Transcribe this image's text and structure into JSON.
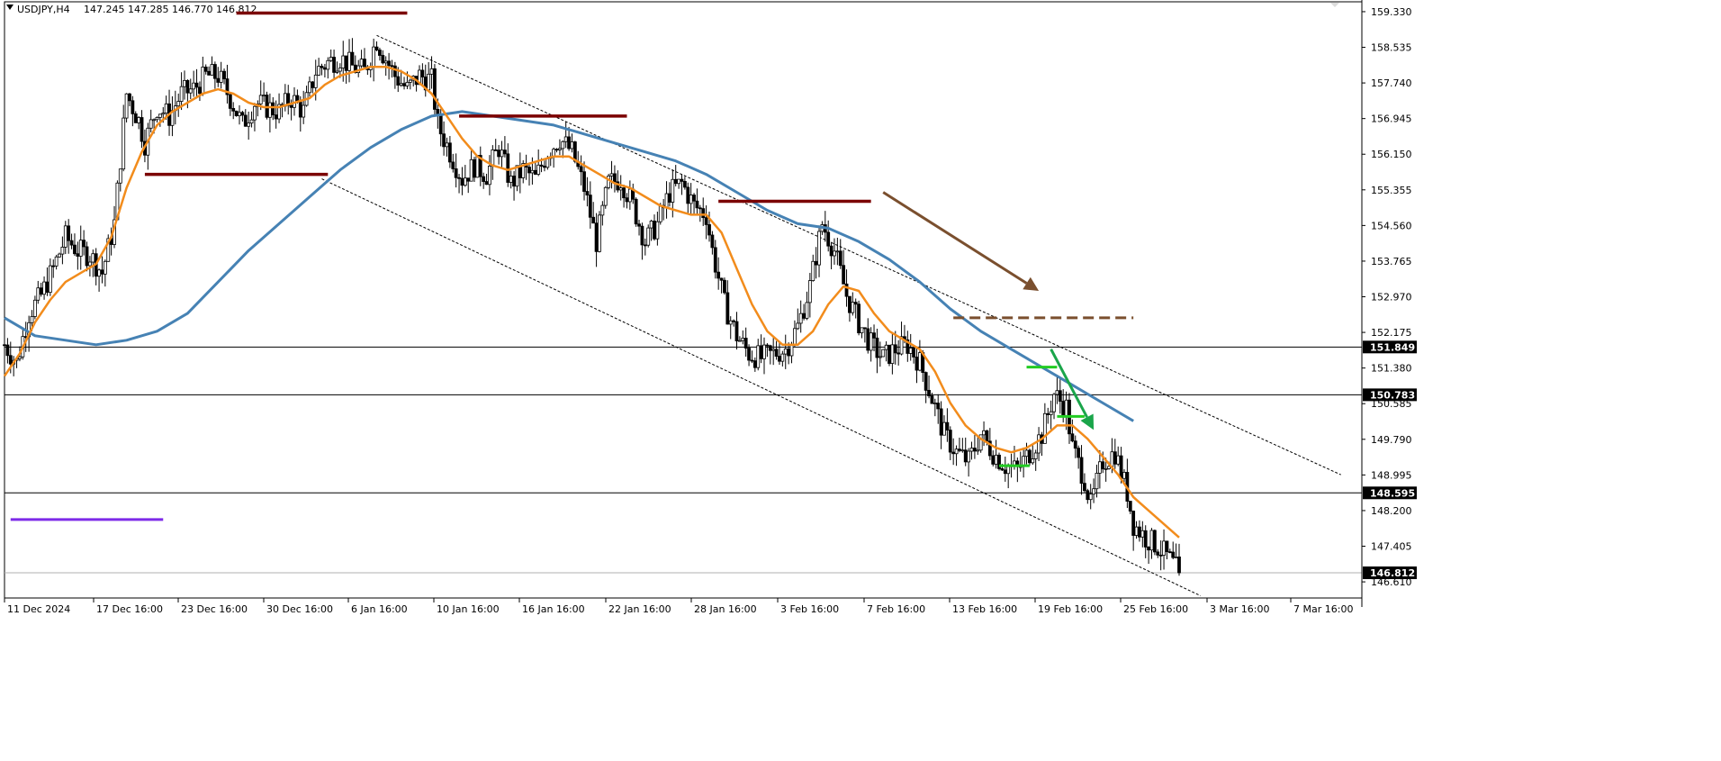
{
  "header": {
    "symbol": "USDJPY,H4",
    "ohlc": "147.245 147.285 146.770 146.812"
  },
  "colors": {
    "background": "#ffffff",
    "candle": "#000000",
    "fast_ma": "#f28c1c",
    "slow_ma": "#4682b4",
    "resistance": "#7b0000",
    "support": "#7d2ae8",
    "projection": "#7a4f2e",
    "signal": "#22cc22",
    "signal_arrow": "#1aa54a",
    "level_line": "#000000",
    "channel": "#000000"
  },
  "chart_data": {
    "type": "candlestick",
    "symbol": "USDJPY",
    "timeframe": "H4",
    "y_ticks": [
      "159.330",
      "158.535",
      "157.740",
      "156.945",
      "156.150",
      "155.355",
      "154.560",
      "153.765",
      "152.970",
      "152.175",
      "151.380",
      "150.585",
      "149.790",
      "148.995",
      "148.200",
      "147.405",
      "146.610"
    ],
    "y_range": [
      146.25,
      159.55
    ],
    "x_ticks": [
      "11 Dec 2024",
      "17 Dec 16:00",
      "23 Dec 16:00",
      "30 Dec 16:00",
      "6 Jan 16:00",
      "10 Jan 16:00",
      "16 Jan 16:00",
      "22 Jan 16:00",
      "28 Jan 16:00",
      "3 Feb 16:00",
      "7 Feb 16:00",
      "13 Feb 16:00",
      "19 Feb 16:00",
      "25 Feb 16:00",
      "3 Mar 16:00",
      "7 Mar 16:00"
    ],
    "x_range_bars": [
      0,
      500
    ],
    "last_bar": 385,
    "price_badges": [
      {
        "label": "151.849",
        "value": 151.849,
        "line": true
      },
      {
        "label": "150.783",
        "value": 150.783,
        "line": true
      },
      {
        "label": "148.595",
        "value": 148.595,
        "line": true
      },
      {
        "label": "146.812",
        "value": 146.812,
        "line": false
      }
    ],
    "price_path": [
      [
        0,
        151.9
      ],
      [
        4,
        151.5
      ],
      [
        8,
        152.6
      ],
      [
        12,
        153.0
      ],
      [
        16,
        153.6
      ],
      [
        20,
        154.3
      ],
      [
        24,
        154.0
      ],
      [
        28,
        153.9
      ],
      [
        32,
        153.5
      ],
      [
        36,
        154.6
      ],
      [
        40,
        157.5
      ],
      [
        44,
        156.9
      ],
      [
        46,
        156.4
      ],
      [
        50,
        157.2
      ],
      [
        54,
        157.0
      ],
      [
        58,
        157.5
      ],
      [
        62,
        157.6
      ],
      [
        66,
        157.9
      ],
      [
        70,
        157.9
      ],
      [
        74,
        157.4
      ],
      [
        78,
        156.8
      ],
      [
        82,
        157.3
      ],
      [
        86,
        157.2
      ],
      [
        90,
        157.1
      ],
      [
        94,
        157.4
      ],
      [
        98,
        157.1
      ],
      [
        102,
        158.0
      ],
      [
        106,
        158.2
      ],
      [
        110,
        158.3
      ],
      [
        114,
        158.1
      ],
      [
        118,
        158.0
      ],
      [
        122,
        158.7
      ],
      [
        124,
        158.4
      ],
      [
        128,
        157.9
      ],
      [
        132,
        157.6
      ],
      [
        136,
        157.9
      ],
      [
        140,
        157.8
      ],
      [
        142,
        156.8
      ],
      [
        146,
        156.2
      ],
      [
        150,
        155.6
      ],
      [
        154,
        155.9
      ],
      [
        158,
        155.7
      ],
      [
        162,
        156.3
      ],
      [
        166,
        155.5
      ],
      [
        170,
        155.8
      ],
      [
        174,
        155.6
      ],
      [
        178,
        156.2
      ],
      [
        182,
        156.5
      ],
      [
        186,
        156.2
      ],
      [
        190,
        155.4
      ],
      [
        194,
        154.2
      ],
      [
        198,
        155.5
      ],
      [
        202,
        155.6
      ],
      [
        206,
        155.0
      ],
      [
        210,
        154.2
      ],
      [
        214,
        154.6
      ],
      [
        218,
        155.3
      ],
      [
        222,
        155.5
      ],
      [
        226,
        155.0
      ],
      [
        230,
        154.8
      ],
      [
        232,
        154.0
      ],
      [
        236,
        152.8
      ],
      [
        240,
        152.1
      ],
      [
        244,
        151.7
      ],
      [
        248,
        151.6
      ],
      [
        252,
        151.7
      ],
      [
        256,
        151.8
      ],
      [
        260,
        152.3
      ],
      [
        264,
        153.2
      ],
      [
        268,
        154.6
      ],
      [
        272,
        154.0
      ],
      [
        276,
        153.0
      ],
      [
        280,
        152.4
      ],
      [
        284,
        151.9
      ],
      [
        288,
        151.6
      ],
      [
        292,
        151.8
      ],
      [
        296,
        151.9
      ],
      [
        300,
        151.5
      ],
      [
        304,
        150.7
      ],
      [
        308,
        149.9
      ],
      [
        312,
        149.5
      ],
      [
        316,
        149.3
      ],
      [
        320,
        149.9
      ],
      [
        324,
        149.5
      ],
      [
        328,
        149.2
      ],
      [
        332,
        149.1
      ],
      [
        336,
        149.5
      ],
      [
        340,
        149.9
      ],
      [
        344,
        150.8
      ],
      [
        348,
        150.5
      ],
      [
        350,
        149.6
      ],
      [
        354,
        148.9
      ],
      [
        356,
        148.3
      ],
      [
        360,
        149.3
      ],
      [
        364,
        149.5
      ],
      [
        368,
        148.6
      ],
      [
        370,
        147.9
      ],
      [
        374,
        147.6
      ],
      [
        378,
        147.4
      ],
      [
        382,
        147.1
      ],
      [
        385,
        146.812
      ]
    ],
    "fast_ma_points": [
      [
        0,
        151.2
      ],
      [
        5,
        151.7
      ],
      [
        10,
        152.4
      ],
      [
        15,
        152.9
      ],
      [
        20,
        153.3
      ],
      [
        25,
        153.5
      ],
      [
        30,
        153.7
      ],
      [
        35,
        154.3
      ],
      [
        40,
        155.4
      ],
      [
        45,
        156.2
      ],
      [
        50,
        156.8
      ],
      [
        55,
        157.1
      ],
      [
        60,
        157.3
      ],
      [
        65,
        157.5
      ],
      [
        70,
        157.6
      ],
      [
        75,
        157.5
      ],
      [
        80,
        157.3
      ],
      [
        85,
        157.2
      ],
      [
        90,
        157.2
      ],
      [
        95,
        157.3
      ],
      [
        100,
        157.4
      ],
      [
        105,
        157.7
      ],
      [
        110,
        157.9
      ],
      [
        115,
        158.0
      ],
      [
        120,
        158.1
      ],
      [
        125,
        158.1
      ],
      [
        130,
        158.0
      ],
      [
        135,
        157.8
      ],
      [
        140,
        157.5
      ],
      [
        145,
        157.0
      ],
      [
        150,
        156.5
      ],
      [
        155,
        156.1
      ],
      [
        160,
        155.9
      ],
      [
        165,
        155.8
      ],
      [
        170,
        155.9
      ],
      [
        175,
        156.0
      ],
      [
        180,
        156.1
      ],
      [
        185,
        156.1
      ],
      [
        190,
        155.9
      ],
      [
        195,
        155.7
      ],
      [
        200,
        155.5
      ],
      [
        205,
        155.4
      ],
      [
        210,
        155.2
      ],
      [
        215,
        155.0
      ],
      [
        220,
        154.9
      ],
      [
        225,
        154.8
      ],
      [
        230,
        154.8
      ],
      [
        235,
        154.4
      ],
      [
        240,
        153.6
      ],
      [
        245,
        152.8
      ],
      [
        250,
        152.2
      ],
      [
        255,
        151.9
      ],
      [
        260,
        151.9
      ],
      [
        265,
        152.2
      ],
      [
        270,
        152.8
      ],
      [
        275,
        153.2
      ],
      [
        280,
        153.1
      ],
      [
        285,
        152.6
      ],
      [
        290,
        152.2
      ],
      [
        295,
        152.0
      ],
      [
        300,
        151.8
      ],
      [
        305,
        151.3
      ],
      [
        310,
        150.6
      ],
      [
        315,
        150.1
      ],
      [
        320,
        149.8
      ],
      [
        325,
        149.6
      ],
      [
        330,
        149.5
      ],
      [
        335,
        149.6
      ],
      [
        340,
        149.8
      ],
      [
        345,
        150.1
      ],
      [
        350,
        150.1
      ],
      [
        355,
        149.8
      ],
      [
        360,
        149.4
      ],
      [
        365,
        149.0
      ],
      [
        370,
        148.5
      ],
      [
        375,
        148.2
      ],
      [
        380,
        147.9
      ],
      [
        385,
        147.6
      ]
    ],
    "slow_ma_points": [
      [
        0,
        152.5
      ],
      [
        10,
        152.1
      ],
      [
        20,
        152.0
      ],
      [
        30,
        151.9
      ],
      [
        40,
        152.0
      ],
      [
        50,
        152.2
      ],
      [
        60,
        152.6
      ],
      [
        70,
        153.3
      ],
      [
        80,
        154.0
      ],
      [
        90,
        154.6
      ],
      [
        100,
        155.2
      ],
      [
        110,
        155.8
      ],
      [
        120,
        156.3
      ],
      [
        130,
        156.7
      ],
      [
        140,
        157.0
      ],
      [
        150,
        157.1
      ],
      [
        160,
        157.0
      ],
      [
        170,
        156.9
      ],
      [
        180,
        156.8
      ],
      [
        190,
        156.6
      ],
      [
        200,
        156.4
      ],
      [
        210,
        156.2
      ],
      [
        220,
        156.0
      ],
      [
        230,
        155.7
      ],
      [
        240,
        155.3
      ],
      [
        250,
        154.9
      ],
      [
        260,
        154.6
      ],
      [
        270,
        154.5
      ],
      [
        280,
        154.2
      ],
      [
        290,
        153.8
      ],
      [
        300,
        153.3
      ],
      [
        310,
        152.7
      ],
      [
        320,
        152.2
      ],
      [
        330,
        151.8
      ],
      [
        340,
        151.4
      ],
      [
        350,
        151.0
      ],
      [
        360,
        150.6
      ],
      [
        370,
        150.2
      ]
    ],
    "channel_lines": [
      {
        "from": [
          122,
          158.8
        ],
        "to": [
          438,
          149.0
        ]
      },
      {
        "from": [
          104,
          155.6
        ],
        "to": [
          392,
          146.3
        ]
      }
    ],
    "resistance_segments": [
      {
        "from": [
          76,
          159.3
        ],
        "to": [
          132,
          159.3
        ]
      },
      {
        "from": [
          46,
          155.7
        ],
        "to": [
          106,
          155.7
        ]
      },
      {
        "from": [
          149,
          157.0
        ],
        "to": [
          204,
          157.0
        ]
      },
      {
        "from": [
          234,
          155.1
        ],
        "to": [
          284,
          155.1
        ]
      }
    ],
    "support_segment": {
      "from": [
        2,
        148.0
      ],
      "to": [
        52,
        148.0
      ]
    },
    "projection_segment": {
      "from": [
        311,
        152.5
      ],
      "to": [
        370,
        152.5
      ]
    },
    "projection_arrow": {
      "from": [
        288,
        155.3
      ],
      "to": [
        339,
        153.1
      ]
    },
    "signal_segments": [
      {
        "from": [
          335,
          151.4
        ],
        "to": [
          345,
          151.4
        ]
      },
      {
        "from": [
          345,
          150.3
        ],
        "to": [
          354,
          150.3
        ]
      },
      {
        "from": [
          326,
          149.2
        ],
        "to": [
          336,
          149.2
        ]
      }
    ],
    "signal_arrow": {
      "from": [
        343,
        151.8
      ],
      "to": [
        357,
        150.0
      ]
    }
  }
}
